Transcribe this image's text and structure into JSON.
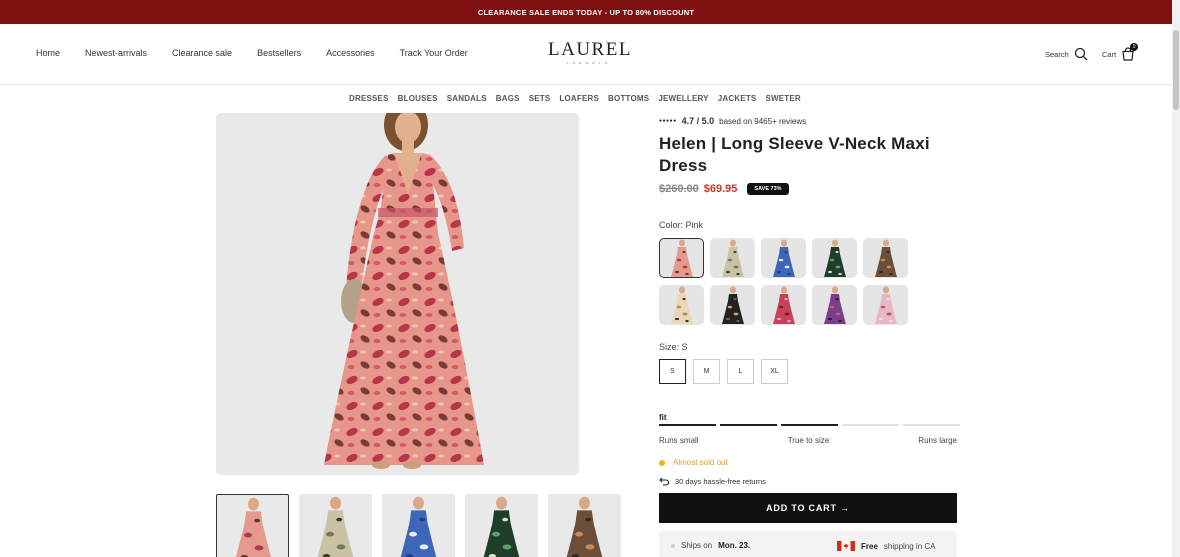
{
  "promo": {
    "text": "CLEARANCE SALE ENDS TODAY - UP TO 80% DISCOUNT"
  },
  "nav": {
    "items": [
      "Home",
      "Newest-arrivals",
      "Clearance sale",
      "Bestsellers",
      "Accessories",
      "Track Your Order"
    ]
  },
  "logo": {
    "main": "LAUREL",
    "sub": "TORONTO"
  },
  "header": {
    "search_label": "Search",
    "cart_label": "Cart",
    "cart_count": "0"
  },
  "categories": [
    "DRESSES",
    "BLOUSES",
    "SANDALS",
    "BAGS",
    "SETS",
    "LOAFERS",
    "BOTTOMS",
    "JEWELLERY",
    "JACKETS",
    "SWETER"
  ],
  "product": {
    "rating_score": "4.7 / 5.0",
    "rating_text": "based on 9465+ reviews",
    "title": "Helen | Long Sleeve V-Neck Maxi Dress",
    "old_price": "$260.00",
    "new_price": "$69.95",
    "save_badge": "SAVE 73%",
    "color_label": "Color: Pink",
    "size_label": "Size: S",
    "sizes": [
      "S",
      "M",
      "L",
      "XL"
    ],
    "selected_size": "S",
    "fit_label": "fit",
    "fit_level": 0.5,
    "fit_scale": [
      "Runs small",
      "True to size",
      "Runs large"
    ],
    "stock_text": "Almost sold out",
    "returns_text": "30 days hassle-free returns",
    "add_to_cart": "ADD TO CART →",
    "ships_prefix": "Ships on",
    "ships_date": "Mon. 23.",
    "free_label": "Free",
    "free_suffix": "shipping in CA"
  },
  "colors": {
    "promo_bg": "#7f1010",
    "sale_price": "#c0392b",
    "stock_warning": "#f0b020",
    "button_bg": "#111111"
  },
  "swatch_palettes": [
    [
      "#e49a8c",
      "#b33a4a",
      "#5a3a2a"
    ],
    [
      "#c9c2a5",
      "#6f7a5a",
      "#3a3a2a"
    ],
    [
      "#3c66b8",
      "#e7eef8",
      "#1f3f82"
    ],
    [
      "#1f3d2a",
      "#5aa06a",
      "#d9e6c8"
    ],
    [
      "#6b4f3a",
      "#c88a5a",
      "#2f2a26"
    ],
    [
      "#e8d7b8",
      "#b88a4a",
      "#3a2a1a"
    ],
    [
      "#222222",
      "#d8a26a",
      "#8a5a2a"
    ],
    [
      "#c8405a",
      "#6a1f2f",
      "#e7b3bd"
    ],
    [
      "#7a3f86",
      "#c9568a",
      "#2a1a3a"
    ],
    [
      "#e9b7c2",
      "#b8506a",
      "#f3dde2"
    ]
  ],
  "thumb_palettes": [
    [
      "#e49a8c",
      "#b33a4a",
      "#5a3a2a"
    ],
    [
      "#c9c2a5",
      "#6f7a5a",
      "#3a3a2a"
    ],
    [
      "#3c66b8",
      "#e7eef8",
      "#1f3f82"
    ],
    [
      "#1f3d2a",
      "#5aa06a",
      "#d9e6c8"
    ],
    [
      "#6b4f3a",
      "#c88a5a",
      "#2f2a26"
    ]
  ]
}
